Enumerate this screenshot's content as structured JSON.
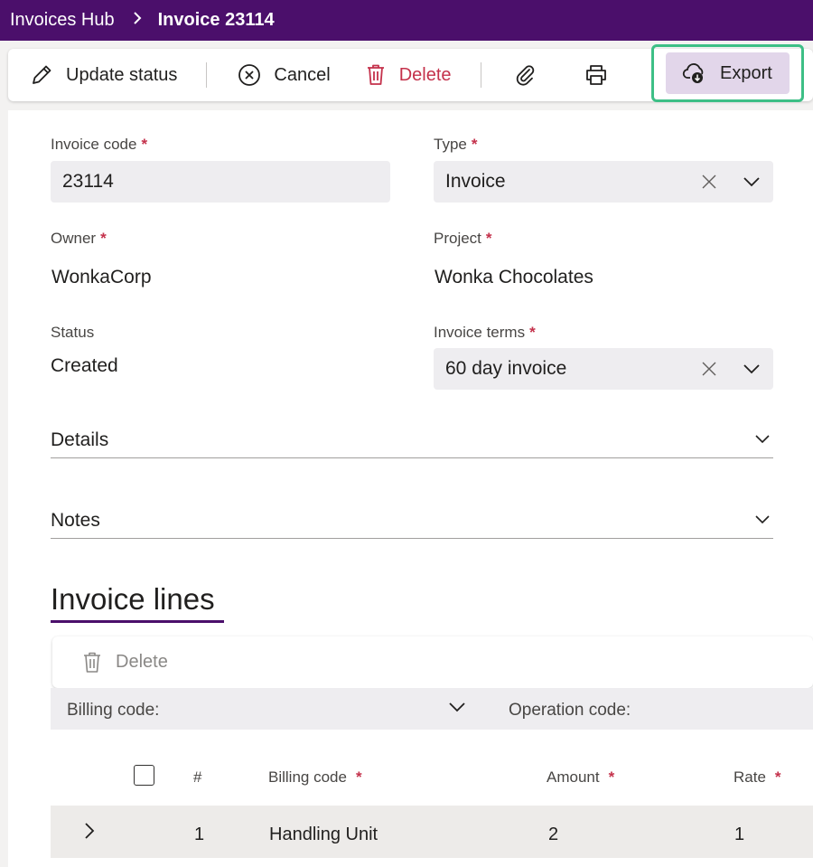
{
  "breadcrumb": {
    "root": "Invoices Hub",
    "current": "Invoice 23114"
  },
  "toolbar": {
    "update_status": "Update status",
    "cancel": "Cancel",
    "delete": "Delete",
    "export": "Export"
  },
  "form": {
    "invoice_code_label": "Invoice code",
    "invoice_code_value": "23114",
    "type_label": "Type",
    "type_value": "Invoice",
    "owner_label": "Owner",
    "owner_value": "WonkaCorp",
    "project_label": "Project",
    "project_value": "Wonka Chocolates",
    "status_label": "Status",
    "status_value": "Created",
    "terms_label": "Invoice terms",
    "terms_value": "60 day invoice",
    "required_marker": "*"
  },
  "sections": {
    "details": "Details",
    "notes": "Notes"
  },
  "invoice_lines": {
    "title": "Invoice lines",
    "delete": "Delete",
    "filter_billing": "Billing code:",
    "filter_operation": "Operation code:",
    "columns": {
      "number": "#",
      "billing_code": "Billing code",
      "amount": "Amount",
      "rate": "Rate"
    },
    "rows": [
      {
        "number": "1",
        "billing_code": "Handling Unit",
        "amount": "2",
        "rate": "1"
      }
    ]
  },
  "colors": {
    "header_bg": "#4b0f6b",
    "export_highlight": "#3dbf86",
    "export_bg": "#e2d6ea",
    "delete_red": "#c4314b"
  }
}
